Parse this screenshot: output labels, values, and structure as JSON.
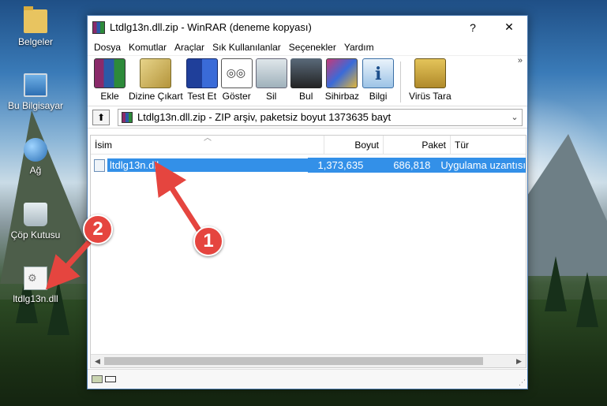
{
  "desktop": {
    "icons": [
      {
        "label": "Belgeler",
        "icon": "folder-icon"
      },
      {
        "label": "Bu Bilgisayar",
        "icon": "computer-icon"
      },
      {
        "label": "Ağ",
        "icon": "network-icon"
      },
      {
        "label": "Çöp Kutusu",
        "icon": "recycle-bin-icon"
      },
      {
        "label": "ltdlg13n.dll",
        "icon": "dll-file-icon"
      }
    ]
  },
  "window": {
    "title": "Ltdlg13n.dll.zip - WinRAR (deneme kopyası)",
    "help_label": "?",
    "close_label": "✕"
  },
  "menu": [
    "Dosya",
    "Komutlar",
    "Araçlar",
    "Sık Kullanılanlar",
    "Seçenekler",
    "Yardım"
  ],
  "toolbar": {
    "tools": [
      {
        "label": "Ekle",
        "icon": "add-archive-icon"
      },
      {
        "label": "Dizine Çıkart",
        "icon": "extract-to-icon"
      },
      {
        "label": "Test Et",
        "icon": "test-icon"
      },
      {
        "label": "Göster",
        "icon": "view-icon"
      },
      {
        "label": "Sil",
        "icon": "delete-icon"
      },
      {
        "label": "Bul",
        "icon": "find-icon"
      },
      {
        "label": "Sihirbaz",
        "icon": "wizard-icon"
      },
      {
        "label": "Bilgi",
        "icon": "info-icon"
      },
      {
        "label": "Virüs Tara",
        "icon": "virus-scan-icon"
      }
    ],
    "more_label": "»"
  },
  "pathbar": {
    "up_label": "⬆",
    "path": "Ltdlg13n.dll.zip - ZIP arşiv, paketsiz boyut 1373635 bayt"
  },
  "list": {
    "columns": {
      "name": "İsim",
      "size": "Boyut",
      "packed": "Paket",
      "type": "Tür"
    },
    "rows": [
      {
        "name": "ltdlg13n.dll",
        "size": "1,373,635",
        "packed": "686,818",
        "type": "Uygulama uzantısı"
      }
    ]
  },
  "annotations": {
    "step1": "1",
    "step2": "2",
    "color": "#e5453f"
  },
  "accent": {
    "selection": "#3390e8"
  }
}
